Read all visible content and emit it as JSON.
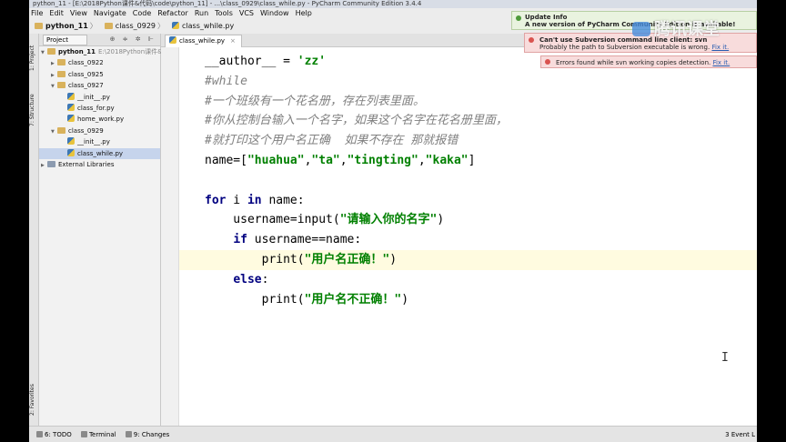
{
  "window": {
    "title": "python_11 - [E:\\2018Python课件&代码\\code\\python_11] - ...\\class_0929\\class_while.py - PyCharm Community Edition 3.4.4"
  },
  "menu": [
    "File",
    "Edit",
    "View",
    "Navigate",
    "Code",
    "Refactor",
    "Run",
    "Tools",
    "VCS",
    "Window",
    "Help"
  ],
  "breadcrumb": [
    "python_11",
    "class_0929",
    "class_while.py"
  ],
  "left_tool_tabs": [
    "1: Project",
    "7: Structure",
    "2: Favorites"
  ],
  "project_panel": {
    "title": "Project",
    "tools": "⊕ ≑ ✲ ⊩",
    "tree": [
      {
        "label": "python_11",
        "hint": "E:\\2018Python课件&代",
        "kind": "folder",
        "level": 0,
        "expanded": true,
        "bold": true
      },
      {
        "label": "class_0922",
        "kind": "folder",
        "level": 1,
        "expanded": false
      },
      {
        "label": "class_0925",
        "kind": "folder",
        "level": 1,
        "expanded": false
      },
      {
        "label": "class_0927",
        "kind": "folder",
        "level": 1,
        "expanded": true
      },
      {
        "label": "__init__.py",
        "kind": "py",
        "level": 2
      },
      {
        "label": "class_for.py",
        "kind": "py",
        "level": 2
      },
      {
        "label": "home_work.py",
        "kind": "py",
        "level": 2
      },
      {
        "label": "class_0929",
        "kind": "folder",
        "level": 1,
        "expanded": true
      },
      {
        "label": "__init__.py",
        "kind": "py",
        "level": 2
      },
      {
        "label": "class_while.py",
        "kind": "py",
        "level": 2,
        "selected": true
      },
      {
        "label": "External Libraries",
        "kind": "lib",
        "level": 0,
        "expanded": false
      }
    ]
  },
  "editor": {
    "tab": "class_while.py",
    "lines": [
      [
        {
          "t": "__author__ = ",
          "c": "var"
        },
        {
          "t": "'zz'",
          "c": "str"
        }
      ],
      [
        {
          "t": "#while",
          "c": "cmt"
        }
      ],
      [
        {
          "t": "#一个班级有一个花名册，存在列表里面。",
          "c": "cmt"
        }
      ],
      [
        {
          "t": "#你从控制台输入一个名字，如果这个名字在花名册里面，",
          "c": "cmt"
        }
      ],
      [
        {
          "t": "#就打印这个用户名正确  如果不存在 那就报错",
          "c": "cmt"
        }
      ],
      [
        {
          "t": "name=[",
          "c": "var"
        },
        {
          "t": "\"huahua\"",
          "c": "str"
        },
        {
          "t": ",",
          "c": "var"
        },
        {
          "t": "\"ta\"",
          "c": "str"
        },
        {
          "t": ",",
          "c": "var"
        },
        {
          "t": "\"tingting\"",
          "c": "str"
        },
        {
          "t": ",",
          "c": "var"
        },
        {
          "t": "\"kaka\"",
          "c": "str"
        },
        {
          "t": "]",
          "c": "var"
        }
      ],
      [],
      [
        {
          "t": "for",
          "c": "kw"
        },
        {
          "t": " i ",
          "c": "var"
        },
        {
          "t": "in",
          "c": "kw"
        },
        {
          "t": " name:",
          "c": "var"
        }
      ],
      [
        {
          "t": "    username=input(",
          "c": "var"
        },
        {
          "t": "\"请输入你的名字\"",
          "c": "str"
        },
        {
          "t": ")",
          "c": "var"
        }
      ],
      [
        {
          "t": "    ",
          "c": "var"
        },
        {
          "t": "if",
          "c": "kw"
        },
        {
          "t": " username==name:",
          "c": "var"
        }
      ],
      [
        {
          "t": "        print(",
          "c": "var"
        },
        {
          "t": "\"用户名正确！\"",
          "c": "str"
        },
        {
          "t": ")",
          "c": "var"
        }
      ],
      [
        {
          "t": "    ",
          "c": "var"
        },
        {
          "t": "else",
          "c": "kw"
        },
        {
          "t": ":",
          "c": "var"
        }
      ],
      [
        {
          "t": "        print(",
          "c": "var"
        },
        {
          "t": "\"用户名不正确！\"",
          "c": "str"
        },
        {
          "t": ")",
          "c": "var"
        }
      ]
    ],
    "highlighted_line": 10
  },
  "bottom_tabs": [
    "6: TODO",
    "Terminal",
    "9: Changes"
  ],
  "bottom_right": "3 Event L",
  "notifications": {
    "info": {
      "title": "Update Info",
      "body": "A new version of PyCharm Community Edition is available!"
    },
    "error1": {
      "title": "Can't use Subversion command line client: svn",
      "body": "Probably the path to Subversion executable is wrong.",
      "link": "Fix it."
    },
    "error2": {
      "body": "Errors found while svn working copies detection.",
      "link": "Fix it."
    }
  },
  "watermark": "腾讯课堂"
}
